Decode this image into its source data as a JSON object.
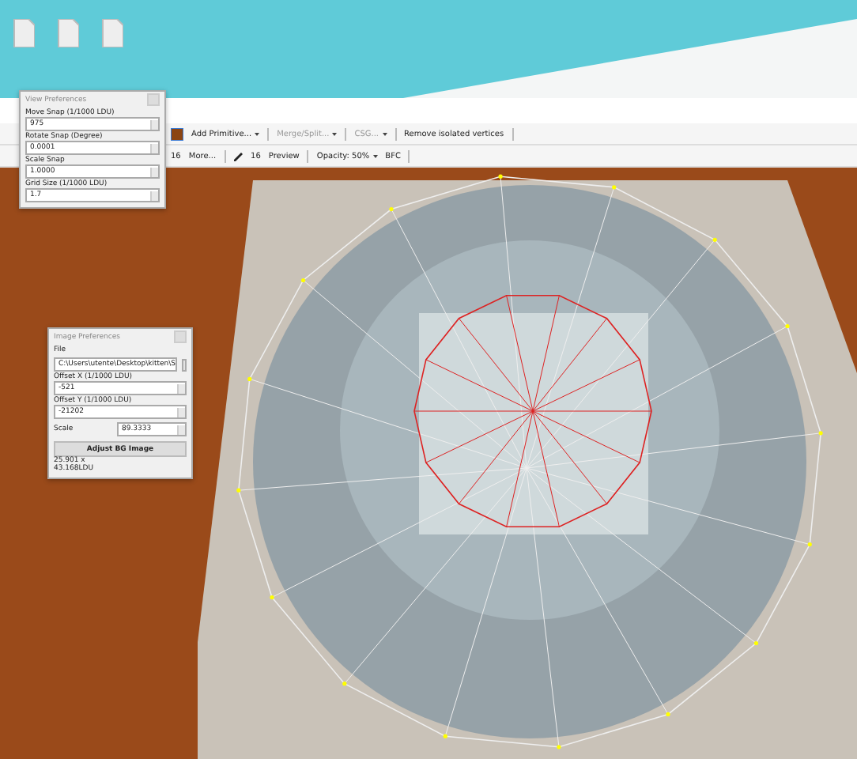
{
  "toolbar": {
    "row_1": [
      {
        "label": "Add Primitive...",
        "kind": "dropdown",
        "disabled": false
      },
      {
        "label": "Merge/Split...",
        "kind": "dropdown",
        "disabled": true
      },
      {
        "label": "CSG...",
        "kind": "dropdown",
        "disabled": true
      },
      {
        "label": "Remove isolated vertices",
        "kind": "button",
        "disabled": false
      }
    ],
    "row_2": [
      {
        "label": "16",
        "kind": "text"
      },
      {
        "label": "More...",
        "kind": "button"
      },
      {
        "label": "16",
        "kind": "pen"
      },
      {
        "label": "Preview",
        "kind": "text"
      },
      {
        "label": "Opacity: 50%",
        "kind": "dropdown"
      },
      {
        "label": "BFC",
        "kind": "text"
      }
    ]
  },
  "view_preferences": {
    "title": "View Preferences",
    "fields": [
      {
        "label": "Move Snap (1/1000 LDU)",
        "value": "975"
      },
      {
        "label": "Rotate Snap (Degree)",
        "value": "0.0001"
      },
      {
        "label": "Scale Snap",
        "value": "1.0000"
      },
      {
        "label": "Grid Size (1/1000 LDU)",
        "value": "1.7"
      }
    ]
  },
  "image_preferences": {
    "title": "Image Preferences",
    "file_label": "File",
    "file_value": "C:\\Users\\utente\\Desktop\\kitten\\S",
    "fields": [
      {
        "label": "Offset X (1/1000 LDU)",
        "value": "-521"
      },
      {
        "label": "Offset Y (1/1000 LDU)",
        "value": "-21202"
      }
    ],
    "scale_label": "Scale",
    "scale_value": "89.3333",
    "button": "Adjust BG Image",
    "info": [
      "25.901 x",
      "43.168LDU"
    ]
  }
}
